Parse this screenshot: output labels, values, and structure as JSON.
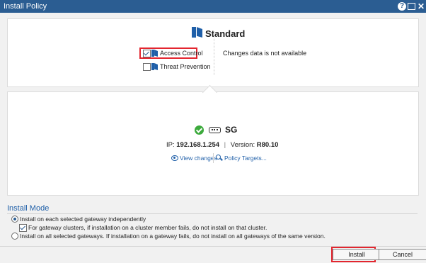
{
  "window": {
    "title": "Install Policy",
    "help_label": "?",
    "close_label": "✕"
  },
  "policy": {
    "name": "Standard",
    "icon": "policy-book-icon",
    "blades": [
      {
        "label": "Access Control",
        "checked": true,
        "highlighted": true
      },
      {
        "label": "Threat Prevention",
        "checked": false,
        "highlighted": false
      }
    ],
    "changes_text": "Changes data is not available"
  },
  "gateway": {
    "name": "SG",
    "status": "ok",
    "ip_label": "IP:",
    "ip": "192.168.1.254",
    "separator": "|",
    "version_label": "Version:",
    "version": "R80.10",
    "view_changes": "View changes",
    "policy_targets": "Policy Targets..."
  },
  "install_mode": {
    "title": "Install Mode",
    "option1": "Install on each selected gateway independently",
    "option1_selected": true,
    "sub_option": "For gateway clusters, if installation on a cluster member fails, do not install on that cluster.",
    "sub_option_checked": true,
    "option2": "Install on all selected gateways. If installation on a gateway fails, do not install on all gateways of the same version.",
    "option2_selected": false
  },
  "buttons": {
    "install": "Install",
    "cancel": "Cancel"
  },
  "colors": {
    "titlebar": "#2b5d92",
    "accent": "#1f5fa8",
    "highlight": "#e3262f",
    "success": "#3caa3c"
  }
}
